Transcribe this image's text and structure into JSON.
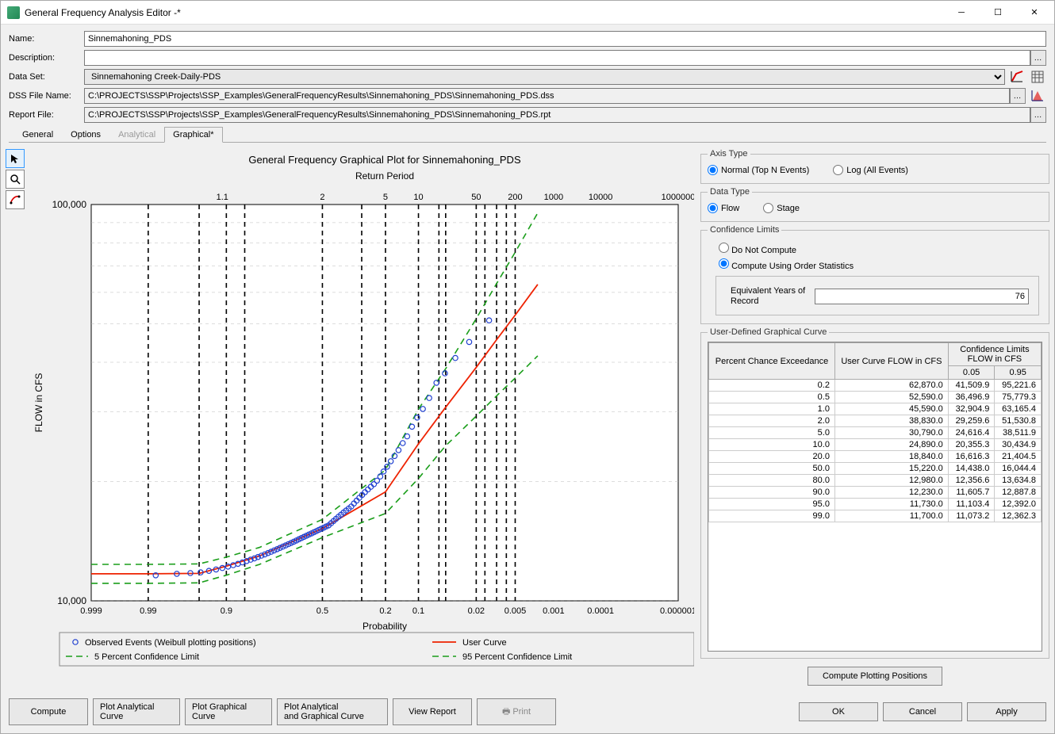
{
  "window": {
    "title": "General Frequency Analysis Editor -*"
  },
  "form": {
    "name_label": "Name:",
    "name_value": "Sinnemahoning_PDS",
    "desc_label": "Description:",
    "desc_value": "",
    "dataset_label": "Data Set:",
    "dataset_value": "Sinnemahoning Creek-Daily-PDS",
    "dss_label": "DSS File Name:",
    "dss_value": "C:\\PROJECTS\\SSP\\Projects\\SSP_Examples\\GeneralFrequencyResults\\Sinnemahoning_PDS\\Sinnemahoning_PDS.dss",
    "report_label": "Report File:",
    "report_value": "C:\\PROJECTS\\SSP\\Projects\\SSP_Examples\\GeneralFrequencyResults\\Sinnemahoning_PDS\\Sinnemahoning_PDS.rpt"
  },
  "tabs": [
    "General",
    "Options",
    "Analytical",
    "Graphical*"
  ],
  "tabs_disabled_index": 2,
  "tabs_active_index": 3,
  "axis_type": {
    "legend": "Axis Type",
    "opt1": "Normal (Top N Events)",
    "opt2": "Log (All Events)",
    "selected": 0
  },
  "data_type": {
    "legend": "Data Type",
    "opt1": "Flow",
    "opt2": "Stage",
    "selected": 0
  },
  "conf": {
    "legend": "Confidence Limits",
    "opt1": "Do Not Compute",
    "opt2": "Compute Using Order Statistics",
    "selected": 1,
    "equiv_label": "Equivalent Years of Record",
    "equiv_value": "76"
  },
  "curve_table": {
    "legend": "User-Defined Graphical Curve",
    "col1": "Percent Chance Exceedance",
    "col2": "User Curve FLOW in CFS",
    "col3": "Confidence Limits\nFLOW in CFS",
    "sub1": "0.05",
    "sub2": "0.95",
    "rows": [
      {
        "p": "0.2",
        "u": "62,870.0",
        "lo": "41,509.9",
        "hi": "95,221.6"
      },
      {
        "p": "0.5",
        "u": "52,590.0",
        "lo": "36,496.9",
        "hi": "75,779.3"
      },
      {
        "p": "1.0",
        "u": "45,590.0",
        "lo": "32,904.9",
        "hi": "63,165.4"
      },
      {
        "p": "2.0",
        "u": "38,830.0",
        "lo": "29,259.6",
        "hi": "51,530.8"
      },
      {
        "p": "5.0",
        "u": "30,790.0",
        "lo": "24,616.4",
        "hi": "38,511.9"
      },
      {
        "p": "10.0",
        "u": "24,890.0",
        "lo": "20,355.3",
        "hi": "30,434.9"
      },
      {
        "p": "20.0",
        "u": "18,840.0",
        "lo": "16,616.3",
        "hi": "21,404.5"
      },
      {
        "p": "50.0",
        "u": "15,220.0",
        "lo": "14,438.0",
        "hi": "16,044.4"
      },
      {
        "p": "80.0",
        "u": "12,980.0",
        "lo": "12,356.6",
        "hi": "13,634.8"
      },
      {
        "p": "90.0",
        "u": "12,230.0",
        "lo": "11,605.7",
        "hi": "12,887.8"
      },
      {
        "p": "95.0",
        "u": "11,730.0",
        "lo": "11,103.4",
        "hi": "12,392.0"
      },
      {
        "p": "99.0",
        "u": "11,700.0",
        "lo": "11,073.2",
        "hi": "12,362.3"
      }
    ]
  },
  "buttons": {
    "compute_positions": "Compute Plotting Positions",
    "compute": "Compute",
    "plot_anal": "Plot Analytical\nCurve",
    "plot_graph": "Plot Graphical\nCurve",
    "plot_both": "Plot Analytical\nand Graphical Curve",
    "view_report": "View Report",
    "print": "Print",
    "ok": "OK",
    "cancel": "Cancel",
    "apply": "Apply"
  },
  "chart_data": {
    "type": "line",
    "title": "General Frequency Graphical Plot for Sinnemahoning_PDS",
    "x_top_label": "Return Period",
    "x_bottom_label": "Probability",
    "ylabel": "FLOW in CFS",
    "y_ticks": [
      10000,
      100000
    ],
    "y_tick_labels": [
      "10,000",
      "100,000"
    ],
    "x_bot_ticks_labels": [
      "0.999",
      "0.99",
      "0.9",
      "0.5",
      "0.2",
      "0.1",
      "0.02",
      "0.005",
      "0.001",
      "0.0001",
      "0.000001"
    ],
    "x_top_ticks_labels": [
      "1.1",
      "2",
      "5",
      "10",
      "50",
      "200",
      "1000",
      "10000",
      "1000000"
    ],
    "x_vline_values": [
      0.99,
      0.95,
      0.9,
      0.85,
      0.5,
      0.3,
      0.2,
      0.1,
      0.06,
      0.05,
      0.02,
      0.015,
      0.01,
      0.007,
      0.005
    ],
    "legend": [
      "Observed Events (Weibull plotting positions)",
      "User Curve",
      "5 Percent Confidence Limit",
      "95 Percent Confidence Limit"
    ],
    "series": {
      "user_curve": [
        {
          "p": 0.99,
          "y": 11700
        },
        {
          "p": 0.95,
          "y": 11730
        },
        {
          "p": 0.9,
          "y": 12230
        },
        {
          "p": 0.8,
          "y": 12980
        },
        {
          "p": 0.5,
          "y": 15220
        },
        {
          "p": 0.2,
          "y": 18840
        },
        {
          "p": 0.1,
          "y": 24890
        },
        {
          "p": 0.05,
          "y": 30790
        },
        {
          "p": 0.02,
          "y": 38830
        },
        {
          "p": 0.01,
          "y": 45590
        },
        {
          "p": 0.005,
          "y": 52590
        },
        {
          "p": 0.002,
          "y": 62870
        }
      ],
      "lo_curve": [
        {
          "p": 0.99,
          "y": 11073.2
        },
        {
          "p": 0.95,
          "y": 11103.4
        },
        {
          "p": 0.9,
          "y": 11605.7
        },
        {
          "p": 0.8,
          "y": 12356.6
        },
        {
          "p": 0.5,
          "y": 14438.0
        },
        {
          "p": 0.2,
          "y": 16616.3
        },
        {
          "p": 0.1,
          "y": 20355.3
        },
        {
          "p": 0.05,
          "y": 24616.4
        },
        {
          "p": 0.02,
          "y": 29259.6
        },
        {
          "p": 0.01,
          "y": 32904.9
        },
        {
          "p": 0.005,
          "y": 36496.9
        },
        {
          "p": 0.002,
          "y": 41509.9
        }
      ],
      "hi_curve": [
        {
          "p": 0.99,
          "y": 12362.3
        },
        {
          "p": 0.95,
          "y": 12392.0
        },
        {
          "p": 0.9,
          "y": 12887.8
        },
        {
          "p": 0.8,
          "y": 13634.8
        },
        {
          "p": 0.5,
          "y": 16044.4
        },
        {
          "p": 0.2,
          "y": 21404.5
        },
        {
          "p": 0.1,
          "y": 30434.9
        },
        {
          "p": 0.05,
          "y": 38511.9
        },
        {
          "p": 0.02,
          "y": 51530.8
        },
        {
          "p": 0.01,
          "y": 63165.4
        },
        {
          "p": 0.005,
          "y": 75779.3
        },
        {
          "p": 0.002,
          "y": 95221.6
        }
      ],
      "observed": [
        {
          "p": 0.987,
          "y": 11600
        },
        {
          "p": 0.974,
          "y": 11700
        },
        {
          "p": 0.961,
          "y": 11750
        },
        {
          "p": 0.948,
          "y": 11800
        },
        {
          "p": 0.935,
          "y": 11900
        },
        {
          "p": 0.922,
          "y": 12000
        },
        {
          "p": 0.909,
          "y": 12100
        },
        {
          "p": 0.896,
          "y": 12200
        },
        {
          "p": 0.883,
          "y": 12300
        },
        {
          "p": 0.87,
          "y": 12400
        },
        {
          "p": 0.857,
          "y": 12500
        },
        {
          "p": 0.844,
          "y": 12600
        },
        {
          "p": 0.831,
          "y": 12700
        },
        {
          "p": 0.818,
          "y": 12800
        },
        {
          "p": 0.805,
          "y": 12900
        },
        {
          "p": 0.792,
          "y": 13000
        },
        {
          "p": 0.779,
          "y": 13100
        },
        {
          "p": 0.766,
          "y": 13200
        },
        {
          "p": 0.753,
          "y": 13300
        },
        {
          "p": 0.74,
          "y": 13400
        },
        {
          "p": 0.727,
          "y": 13500
        },
        {
          "p": 0.714,
          "y": 13600
        },
        {
          "p": 0.701,
          "y": 13700
        },
        {
          "p": 0.688,
          "y": 13800
        },
        {
          "p": 0.675,
          "y": 13900
        },
        {
          "p": 0.662,
          "y": 14000
        },
        {
          "p": 0.649,
          "y": 14100
        },
        {
          "p": 0.636,
          "y": 14200
        },
        {
          "p": 0.623,
          "y": 14300
        },
        {
          "p": 0.61,
          "y": 14400
        },
        {
          "p": 0.597,
          "y": 14500
        },
        {
          "p": 0.584,
          "y": 14600
        },
        {
          "p": 0.571,
          "y": 14700
        },
        {
          "p": 0.558,
          "y": 14800
        },
        {
          "p": 0.545,
          "y": 14900
        },
        {
          "p": 0.532,
          "y": 15000
        },
        {
          "p": 0.519,
          "y": 15100
        },
        {
          "p": 0.506,
          "y": 15200
        },
        {
          "p": 0.493,
          "y": 15300
        },
        {
          "p": 0.48,
          "y": 15400
        },
        {
          "p": 0.467,
          "y": 15500
        },
        {
          "p": 0.454,
          "y": 15700
        },
        {
          "p": 0.441,
          "y": 15900
        },
        {
          "p": 0.428,
          "y": 16100
        },
        {
          "p": 0.415,
          "y": 16300
        },
        {
          "p": 0.402,
          "y": 16500
        },
        {
          "p": 0.389,
          "y": 16700
        },
        {
          "p": 0.376,
          "y": 16900
        },
        {
          "p": 0.363,
          "y": 17100
        },
        {
          "p": 0.35,
          "y": 17300
        },
        {
          "p": 0.337,
          "y": 17600
        },
        {
          "p": 0.324,
          "y": 17900
        },
        {
          "p": 0.311,
          "y": 18200
        },
        {
          "p": 0.298,
          "y": 18500
        },
        {
          "p": 0.285,
          "y": 18800
        },
        {
          "p": 0.272,
          "y": 19100
        },
        {
          "p": 0.259,
          "y": 19400
        },
        {
          "p": 0.246,
          "y": 19700
        },
        {
          "p": 0.233,
          "y": 20100
        },
        {
          "p": 0.22,
          "y": 20600
        },
        {
          "p": 0.207,
          "y": 21200
        },
        {
          "p": 0.194,
          "y": 21800
        },
        {
          "p": 0.181,
          "y": 22500
        },
        {
          "p": 0.168,
          "y": 23200
        },
        {
          "p": 0.155,
          "y": 24000
        },
        {
          "p": 0.142,
          "y": 25000
        },
        {
          "p": 0.129,
          "y": 26000
        },
        {
          "p": 0.116,
          "y": 27500
        },
        {
          "p": 0.103,
          "y": 29000
        },
        {
          "p": 0.09,
          "y": 30500
        },
        {
          "p": 0.077,
          "y": 32500
        },
        {
          "p": 0.064,
          "y": 35500
        },
        {
          "p": 0.051,
          "y": 37500
        },
        {
          "p": 0.038,
          "y": 41000
        },
        {
          "p": 0.025,
          "y": 45000
        },
        {
          "p": 0.013,
          "y": 51000
        }
      ]
    }
  }
}
